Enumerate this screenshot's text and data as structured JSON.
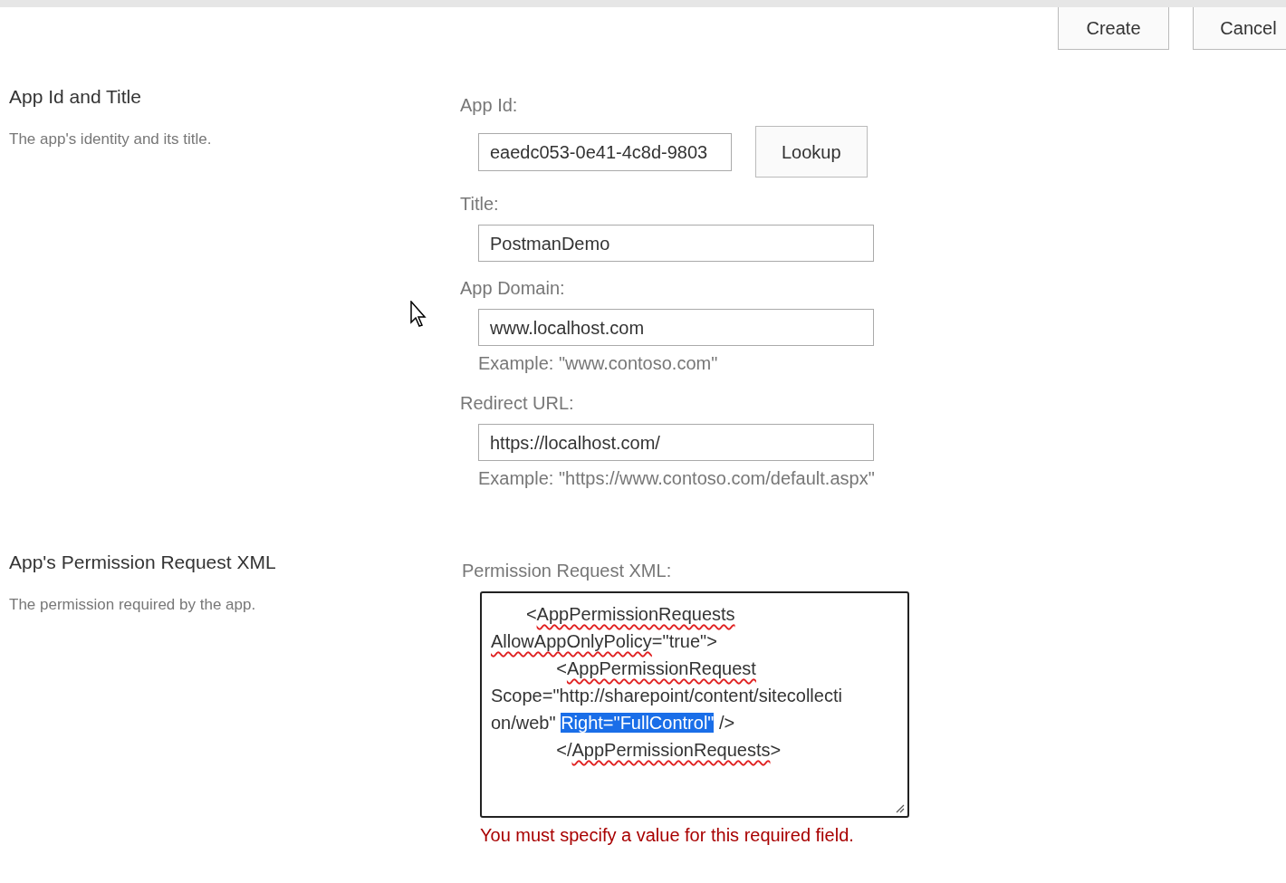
{
  "toolbar": {
    "buttons": [
      "Create",
      "Cancel"
    ]
  },
  "sections": [
    {
      "title": "App Id and Title",
      "description": "The app's identity and its title.",
      "fields": [
        {
          "kind": "lookup",
          "label": "App Id:",
          "value": "eaedc053-0e41-4c8d-9803",
          "button": "Lookup"
        },
        {
          "kind": "text",
          "label": "Title:",
          "value": "PostmanDemo"
        },
        {
          "kind": "text",
          "label": "App Domain:",
          "value": "www.localhost.com",
          "hint": "Example: \"www.contoso.com\""
        },
        {
          "kind": "text",
          "label": "Redirect URL:",
          "value": "https://localhost.com/",
          "hint": "Example: \"https://www.contoso.com/default.aspx\""
        }
      ]
    },
    {
      "title": "App's Permission Request XML",
      "description": "The permission required by the app.",
      "fields": [
        {
          "kind": "xml",
          "label": "Permission Request XML:",
          "error": "You must specify a value for this required field.",
          "lines": [
            [
              {
                "text": "       <",
                "misspelled": false,
                "selected": false
              },
              {
                "text": "AppPermissionRequests",
                "misspelled": true,
                "selected": false
              }
            ],
            [
              {
                "text": "AllowAppOnlyPolicy",
                "misspelled": true,
                "selected": false
              },
              {
                "text": "=\"true\">",
                "misspelled": false,
                "selected": false
              }
            ],
            [
              {
                "text": "             <",
                "misspelled": false,
                "selected": false
              },
              {
                "text": "AppPermissionRequest",
                "misspelled": true,
                "selected": false
              }
            ],
            [
              {
                "text": "Scope=\"http://sharepoint/content/sitecollecti",
                "misspelled": false,
                "selected": false
              }
            ],
            [
              {
                "text": "on/web\" ",
                "misspelled": false,
                "selected": false
              },
              {
                "text": "Right=\"FullControl\"",
                "misspelled": false,
                "selected": true
              },
              {
                "text": " />",
                "misspelled": false,
                "selected": false
              }
            ],
            [
              {
                "text": "             </",
                "misspelled": false,
                "selected": false
              },
              {
                "text": "AppPermissionRequests",
                "misspelled": true,
                "selected": false
              },
              {
                "text": ">",
                "misspelled": false,
                "selected": false
              }
            ]
          ]
        }
      ]
    }
  ]
}
